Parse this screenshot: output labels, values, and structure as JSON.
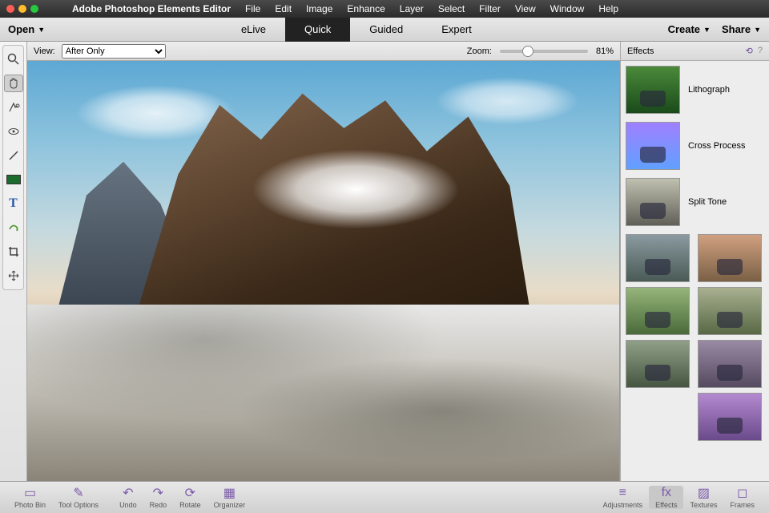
{
  "menubar": {
    "app_name": "Adobe Photoshop Elements Editor",
    "items": [
      "File",
      "Edit",
      "Image",
      "Enhance",
      "Layer",
      "Select",
      "Filter",
      "View",
      "Window",
      "Help"
    ]
  },
  "toolbar": {
    "open": "Open",
    "tabs": {
      "elive": "eLive",
      "quick": "Quick",
      "guided": "Guided",
      "expert": "Expert"
    },
    "create": "Create",
    "share": "Share"
  },
  "options": {
    "view_label": "View:",
    "view_value": "After Only",
    "zoom_label": "Zoom:",
    "zoom_value": "81%"
  },
  "effects_panel": {
    "title": "Effects",
    "named": [
      {
        "label": "Lithograph"
      },
      {
        "label": "Cross Process"
      },
      {
        "label": "Split Tone"
      }
    ]
  },
  "bottombar": {
    "photobin": "Photo Bin",
    "tooloptions": "Tool Options",
    "undo": "Undo",
    "redo": "Redo",
    "rotate": "Rotate",
    "organizer": "Organizer",
    "adjustments": "Adjustments",
    "effects": "Effects",
    "textures": "Textures",
    "frames": "Frames"
  }
}
